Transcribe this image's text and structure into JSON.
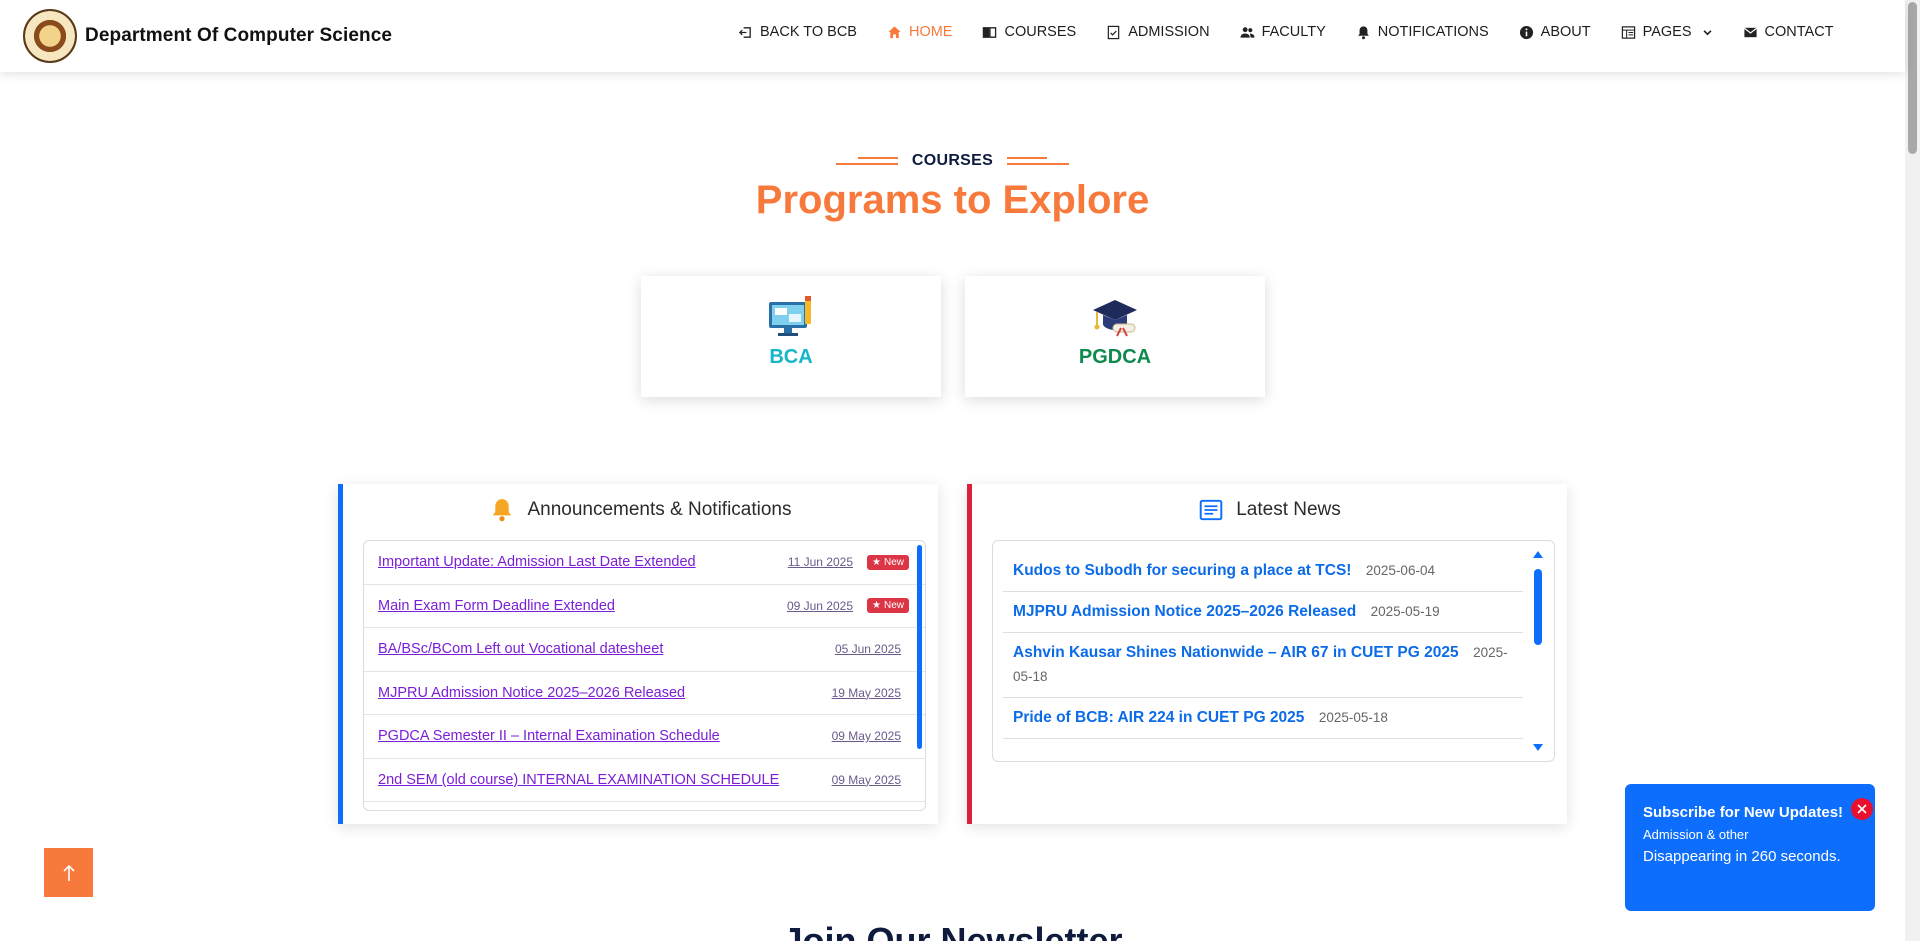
{
  "header": {
    "brand": "Department Of Computer Science",
    "nav": [
      {
        "label": "BACK TO BCB",
        "icon": "back-icon"
      },
      {
        "label": "HOME",
        "icon": "home-icon",
        "active": true
      },
      {
        "label": "COURSES",
        "icon": "book-icon"
      },
      {
        "label": "ADMISSION",
        "icon": "clipboard-check-icon"
      },
      {
        "label": "FACULTY",
        "icon": "users-icon"
      },
      {
        "label": "NOTIFICATIONS",
        "icon": "bell-icon"
      },
      {
        "label": "ABOUT",
        "icon": "info-icon"
      },
      {
        "label": "PAGES",
        "icon": "pages-icon",
        "dropdown": true
      },
      {
        "label": "CONTACT",
        "icon": "mail-icon"
      }
    ]
  },
  "section": {
    "eyebrow": "COURSES",
    "title": "Programs to Explore"
  },
  "courses": [
    {
      "name": "BCA",
      "color": "#16b6c8"
    },
    {
      "name": "PGDCA",
      "color": "#0f8a4e"
    }
  ],
  "announcements": {
    "title": "Announcements & Notifications",
    "items": [
      {
        "title": "Important Update: Admission Last Date Extended",
        "date": "11 Jun 2025",
        "badge": "New"
      },
      {
        "title": "Main Exam Form Deadline Extended",
        "date": "09 Jun 2025",
        "badge": "New"
      },
      {
        "title": "BA/BSc/BCom Left out Vocational datesheet",
        "date": "05 Jun 2025"
      },
      {
        "title": "MJPRU Admission Notice 2025–2026 Released",
        "date": "19 May 2025"
      },
      {
        "title": "PGDCA Semester II – Internal Examination Schedule",
        "date": "09 May 2025"
      },
      {
        "title": "2nd SEM (old course) INTERNAL EXAMINATION SCHEDULE",
        "date": "09 May 2025"
      }
    ]
  },
  "news": {
    "title": "Latest News",
    "items": [
      {
        "title": "Kudos to Subodh for securing a place at TCS!",
        "date": "2025-06-04"
      },
      {
        "title": "MJPRU Admission Notice 2025–2026 Released",
        "date": "2025-05-19"
      },
      {
        "title": "Ashvin Kausar Shines Nationwide – AIR 67 in CUET PG 2025",
        "date": "2025-05-18"
      },
      {
        "title": "Pride of BCB: AIR 224 in CUET PG 2025",
        "date": "2025-05-18"
      }
    ]
  },
  "newsletter": {
    "title": "Join Our Newsletter"
  },
  "toast": {
    "title": "Subscribe for New Updates!",
    "subtitle": "Admission & other",
    "timer": "Disappearing in 260 seconds."
  },
  "colors": {
    "accent": "#f7793b",
    "primary": "#0d6efd",
    "danger": "#dc1f3a"
  }
}
